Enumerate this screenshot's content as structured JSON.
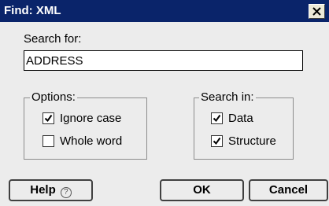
{
  "window": {
    "title": "Find: XML"
  },
  "search": {
    "label": "Search for:",
    "value": "ADDRESS"
  },
  "options": {
    "legend": "Options:",
    "items": [
      {
        "label": "Ignore case",
        "checked": true
      },
      {
        "label": "Whole word",
        "checked": false
      }
    ]
  },
  "search_in": {
    "legend": "Search in:",
    "items": [
      {
        "label": "Data",
        "checked": true
      },
      {
        "label": "Structure",
        "checked": true
      }
    ]
  },
  "buttons": {
    "help": "Help",
    "help_glyph": "?",
    "ok": "OK",
    "cancel": "Cancel"
  },
  "colors": {
    "titlebar": "#0a246a",
    "dialog_bg": "#ececec"
  }
}
